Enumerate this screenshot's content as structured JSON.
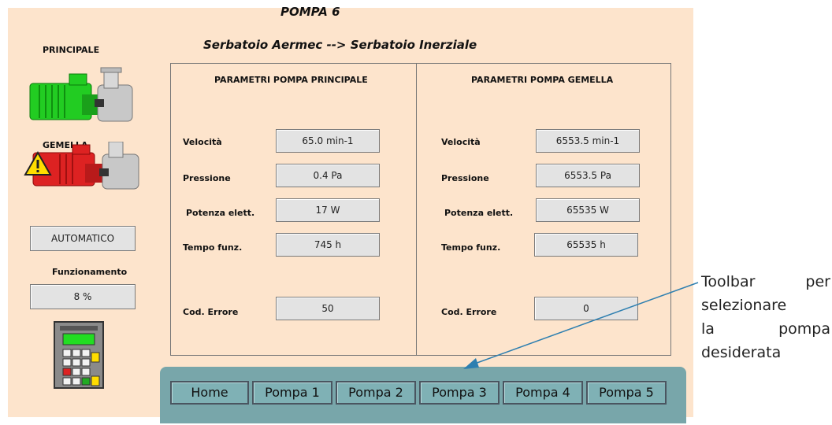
{
  "header": {
    "title": "POMPA 6",
    "subtitle": "Serbatoio Aermec --> Serbatoio Inerziale"
  },
  "left": {
    "principale_label": "PRINCIPALE",
    "gemella_label": "GEMELLA",
    "mode_value": "AUTOMATICO",
    "funzionamento_label": "Funzionamento",
    "funzionamento_value": "8 %"
  },
  "principale": {
    "heading": "PARAMETRI POMPA PRINCIPALE",
    "rows": [
      {
        "label": "Velocità",
        "value": "65.0 min-1"
      },
      {
        "label": "Pressione",
        "value": "0.4 Pa"
      },
      {
        "label": "Potenza elett.",
        "value": "17 W"
      },
      {
        "label": "Tempo funz.",
        "value": "745 h"
      },
      {
        "label": "Cod. Errore",
        "value": "50"
      }
    ]
  },
  "gemella": {
    "heading": "PARAMETRI POMPA GEMELLA",
    "rows": [
      {
        "label": "Velocità",
        "value": "6553.5 min-1"
      },
      {
        "label": "Pressione",
        "value": "6553.5 Pa"
      },
      {
        "label": "Potenza elett.",
        "value": "65535 W"
      },
      {
        "label": "Tempo funz.",
        "value": "65535 h"
      },
      {
        "label": "Cod. Errore",
        "value": "0"
      }
    ]
  },
  "toolbar": {
    "buttons": [
      "Home",
      "Pompa 1",
      "Pompa 2",
      "Pompa 3",
      "Pompa 4",
      "Pompa 5"
    ]
  },
  "annotation": {
    "lines": [
      "Toolbar per",
      "selezionare",
      "la pompa",
      "desiderata"
    ]
  },
  "colors": {
    "panel_bg": "#fde4cc",
    "pump_ok": "#22cc22",
    "pump_fault": "#dd2222",
    "toolbar_bg": "#78a6aa",
    "arrow": "#2e7fb0"
  },
  "icons": [
    "pump-running-icon",
    "pump-fault-icon",
    "warning-icon",
    "keypad-icon"
  ]
}
